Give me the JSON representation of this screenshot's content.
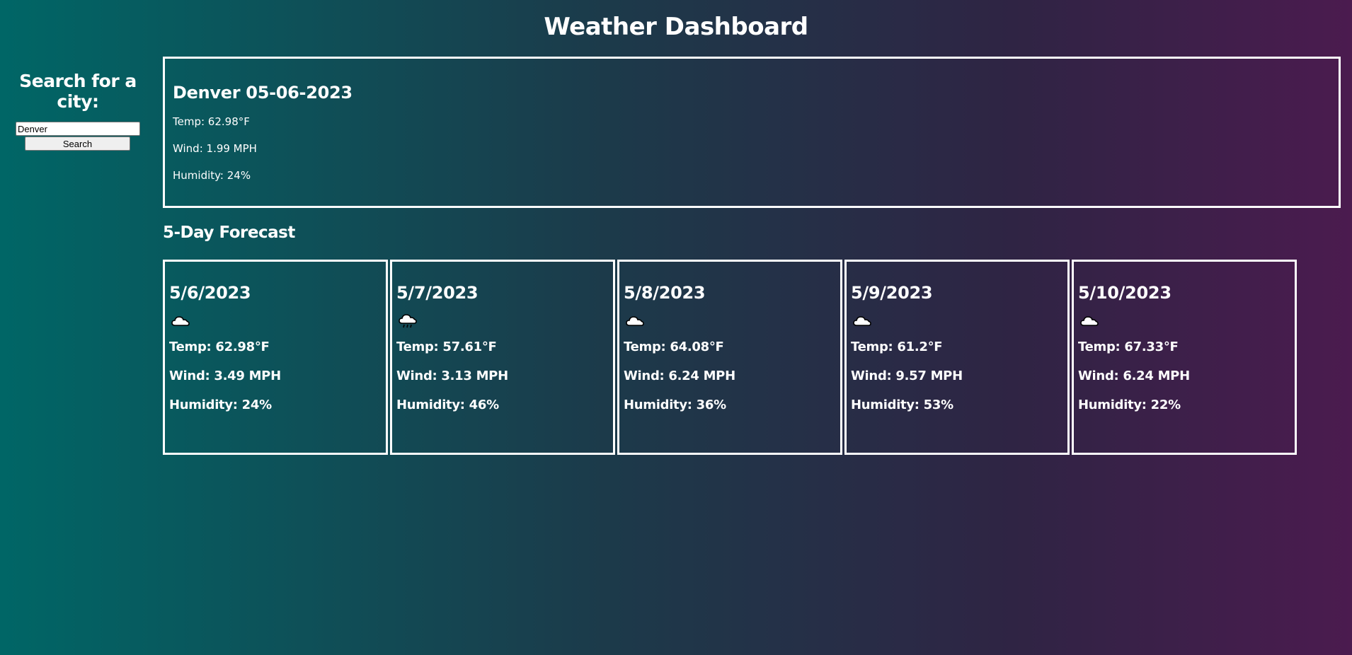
{
  "header": {
    "title": "Weather Dashboard"
  },
  "sidebar": {
    "heading": "Search for a city:",
    "search_value": "Denver",
    "search_button_label": "Search"
  },
  "current": {
    "title": "Denver 05-06-2023",
    "temp": "Temp: 62.98°F",
    "wind": "Wind: 1.99 MPH",
    "humidity": "Humidity: 24%"
  },
  "forecast": {
    "heading": "5-Day Forecast",
    "days": [
      {
        "date": "5/6/2023",
        "icon": "cloud-icon",
        "temp": "Temp: 62.98°F",
        "wind": "Wind: 3.49 MPH",
        "humidity": "Humidity: 24%"
      },
      {
        "date": "5/7/2023",
        "icon": "rain-cloud-icon",
        "temp": "Temp: 57.61°F",
        "wind": "Wind: 3.13 MPH",
        "humidity": "Humidity: 46%"
      },
      {
        "date": "5/8/2023",
        "icon": "cloud-icon",
        "temp": "Temp: 64.08°F",
        "wind": "Wind: 6.24 MPH",
        "humidity": "Humidity: 36%"
      },
      {
        "date": "5/9/2023",
        "icon": "cloud-icon",
        "temp": "Temp: 61.2°F",
        "wind": "Wind: 9.57 MPH",
        "humidity": "Humidity: 53%"
      },
      {
        "date": "5/10/2023",
        "icon": "cloud-icon",
        "temp": "Temp: 67.33°F",
        "wind": "Wind: 6.24 MPH",
        "humidity": "Humidity: 22%"
      }
    ]
  },
  "colors": {
    "gradient_start": "#006666",
    "gradient_end": "#4b1b4f",
    "border": "#ffffff"
  }
}
